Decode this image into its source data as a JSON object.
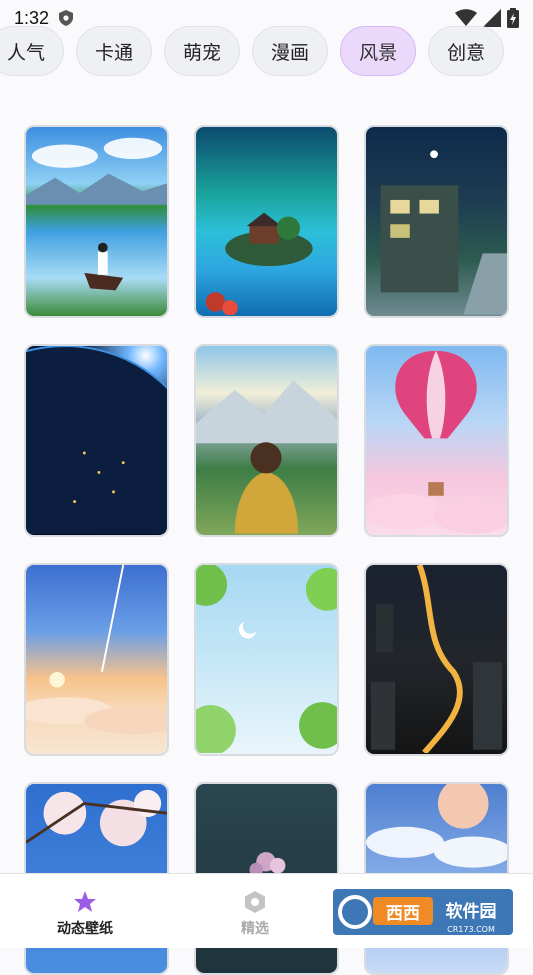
{
  "status": {
    "time": "1:32"
  },
  "categories": [
    {
      "label": "人气",
      "active": false
    },
    {
      "label": "卡通",
      "active": false
    },
    {
      "label": "萌宠",
      "active": false
    },
    {
      "label": "漫画",
      "active": false
    },
    {
      "label": "风景",
      "active": true
    },
    {
      "label": "创意",
      "active": false
    }
  ],
  "wallpapers": [
    {
      "name": "lake-girl-boat"
    },
    {
      "name": "island-house-aurora"
    },
    {
      "name": "night-street"
    },
    {
      "name": "earth-from-space"
    },
    {
      "name": "boy-mountains"
    },
    {
      "name": "pink-hot-air-balloon"
    },
    {
      "name": "sunrise-clouds-comet"
    },
    {
      "name": "leaves-sky-moon"
    },
    {
      "name": "city-night-aerial"
    },
    {
      "name": "cherry-blossoms"
    },
    {
      "name": "dark-flowers"
    },
    {
      "name": "moon-clouds"
    }
  ],
  "tabs": [
    {
      "label": "动态壁纸",
      "icon": "star-icon",
      "active": true
    },
    {
      "label": "精选",
      "icon": "hexagon-icon",
      "active": false
    }
  ],
  "watermark": {
    "text": "西西软件园",
    "sub": "CR173.COM"
  },
  "colors": {
    "accent": "#9b5de5",
    "chip_active_bg": "#ead9fb"
  }
}
